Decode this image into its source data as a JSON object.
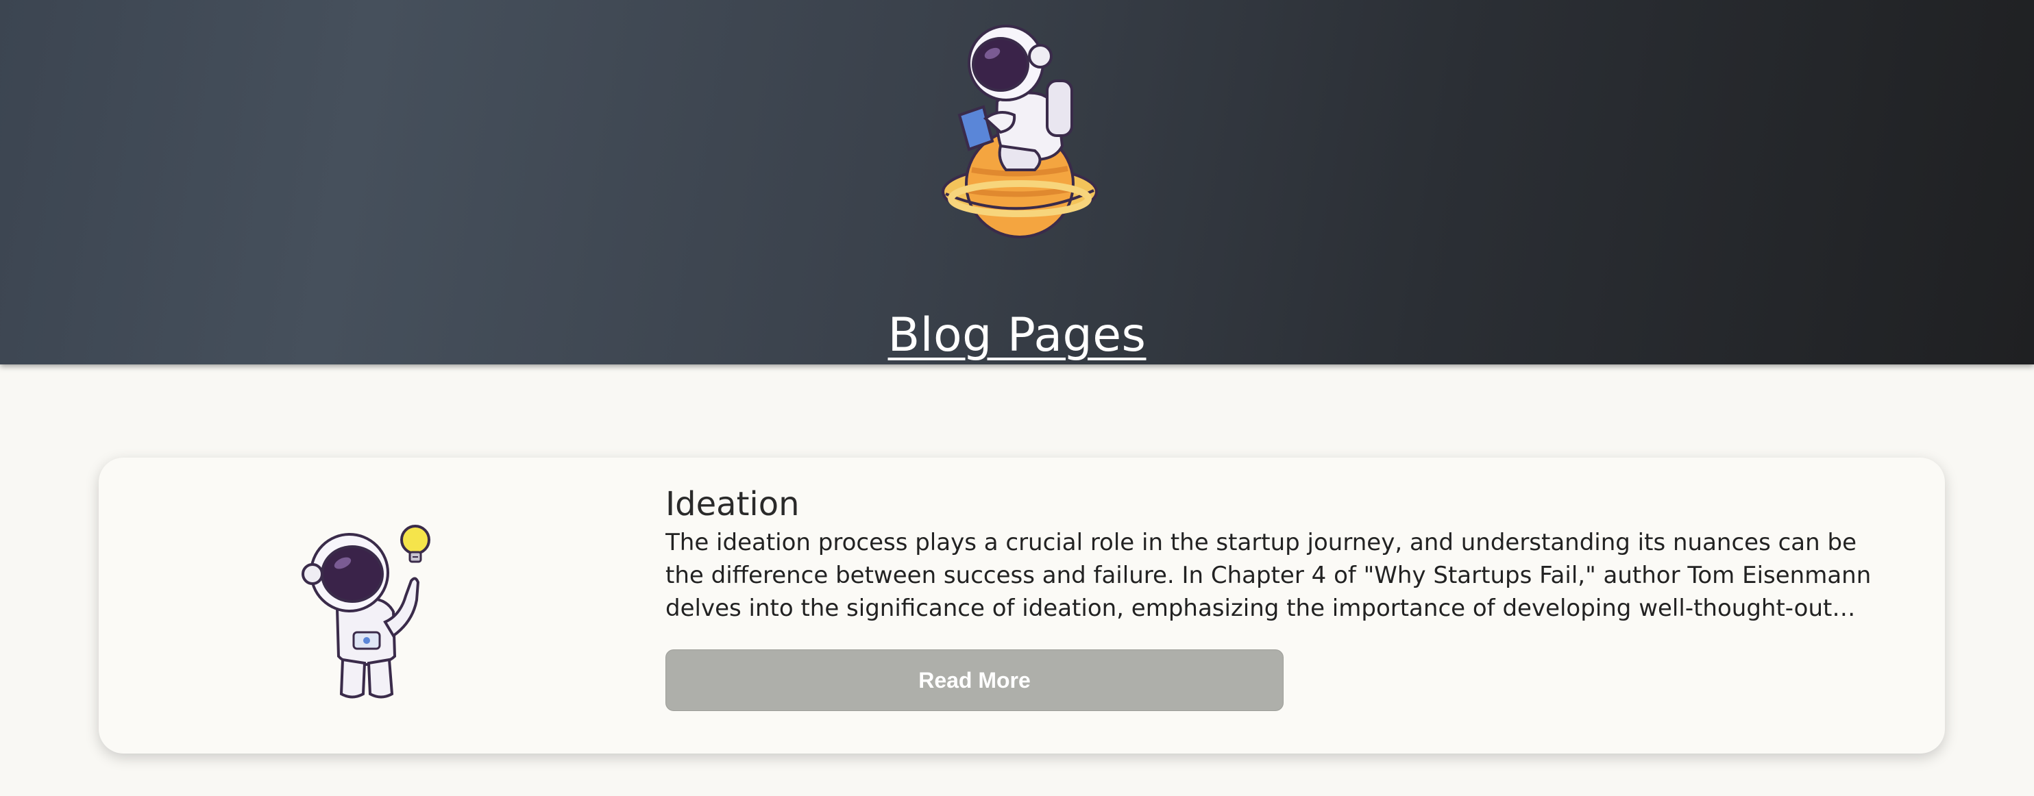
{
  "header": {
    "title": "Blog Pages",
    "illustration_icon": "astronaut-reading-on-planet-icon"
  },
  "posts": [
    {
      "title": "Ideation",
      "excerpt": "The ideation process plays a crucial role in the startup journey, and understanding its nuances can be the difference between success and failure. In Chapter 4 of \"Why Startups Fail,\" author Tom Eisenmann delves into the significance of ideation, emphasizing the importance of developing well-thought-out solutions to identified...",
      "button_label": "Read More",
      "illustration_icon": "astronaut-lightbulb-icon"
    }
  ],
  "colors": {
    "page_background": "#f9f8f4",
    "header_gradient_start": "#46505c",
    "header_gradient_end": "#1f2022",
    "button_background": "#aeafaa"
  }
}
